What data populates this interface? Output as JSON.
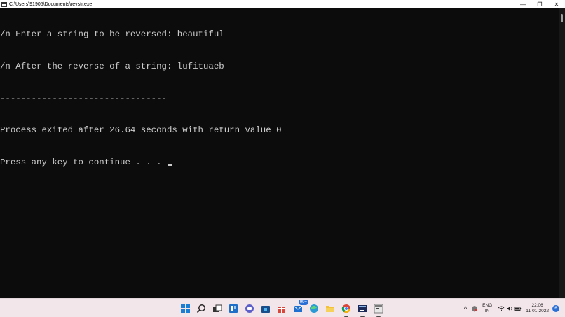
{
  "window": {
    "title": "C:\\Users\\91905\\Documents\\revstr.exe",
    "controls": {
      "minimize": "—",
      "restore": "❐",
      "close": "✕"
    }
  },
  "console": {
    "lines": [
      "/n Enter a string to be reversed: beautiful",
      "/n After the reverse of a string: lufituaeb",
      "--------------------------------",
      "Process exited after 26.64 seconds with return value 0",
      "Press any key to continue . . . "
    ]
  },
  "taskbar": {
    "icons": [
      {
        "name": "start",
        "glyph": ""
      },
      {
        "name": "search",
        "glyph": "⌕"
      },
      {
        "name": "task-view",
        "glyph": "▭"
      },
      {
        "name": "widgets",
        "glyph": "◧"
      },
      {
        "name": "chat",
        "glyph": "◉"
      },
      {
        "name": "store",
        "glyph": "▣"
      },
      {
        "name": "gift",
        "glyph": "▦"
      },
      {
        "name": "mail",
        "glyph": "✉"
      },
      {
        "name": "edge",
        "glyph": "◐"
      },
      {
        "name": "file-explorer",
        "glyph": "▬"
      },
      {
        "name": "chrome",
        "glyph": "◎"
      },
      {
        "name": "devcpp",
        "glyph": "▤"
      },
      {
        "name": "console-app",
        "glyph": "▥"
      }
    ],
    "mail_badge": "99+",
    "tray": {
      "chevron": "^",
      "lang_top": "ENG",
      "lang_bottom": "IN",
      "time": "22:06",
      "date": "11-01-2022",
      "notifications": "6"
    }
  },
  "colors": {
    "console_bg": "#0c0c0c",
    "console_fg": "#cccccc",
    "taskbar_bg": "#f3e6ea",
    "accent": "#1a7fd4"
  }
}
